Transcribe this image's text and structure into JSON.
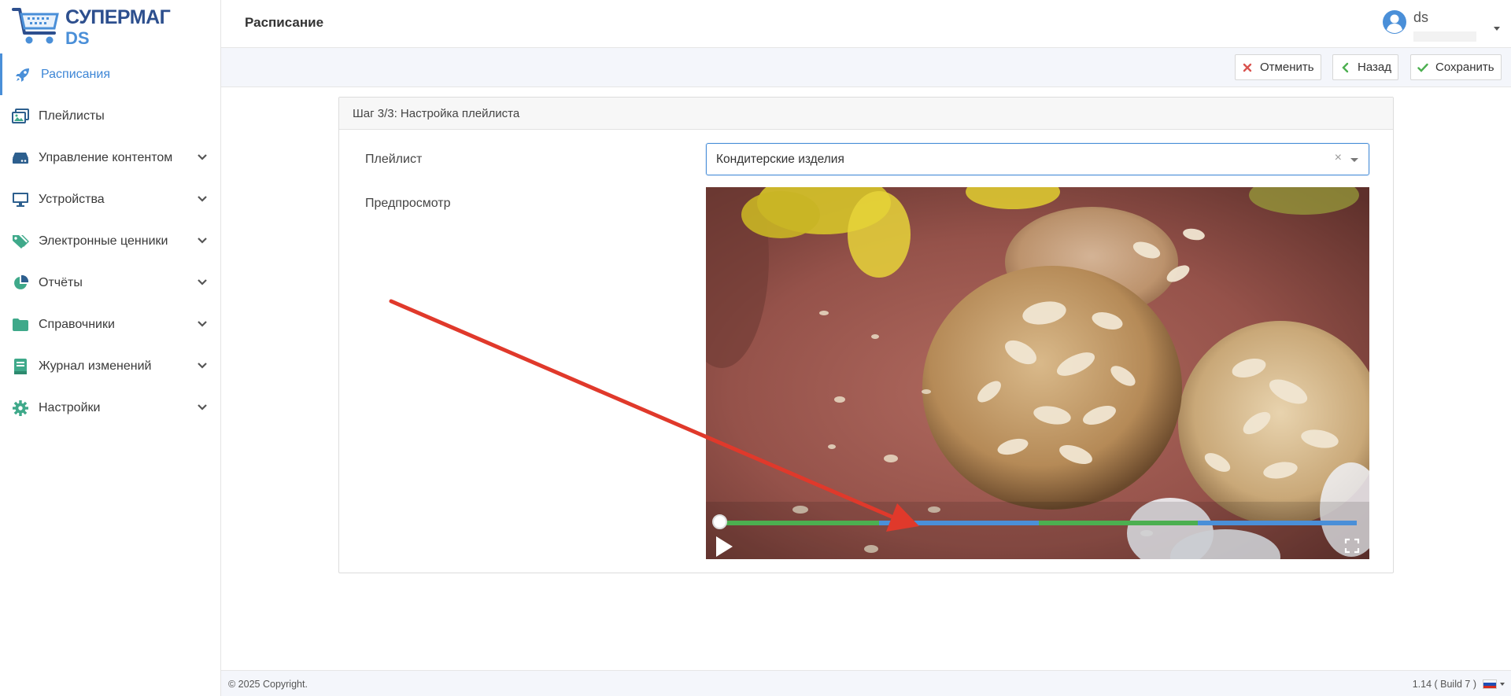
{
  "app": {
    "logo_line1": "СУПЕРМАГ",
    "logo_line2": "DS"
  },
  "sidebar": {
    "items": [
      {
        "label": "Расписания",
        "icon": "rocket-icon",
        "active": true,
        "expandable": false
      },
      {
        "label": "Плейлисты",
        "icon": "images-icon",
        "active": false,
        "expandable": false
      },
      {
        "label": "Управление контентом",
        "icon": "server-icon",
        "active": false,
        "expandable": true
      },
      {
        "label": "Устройства",
        "icon": "desktop-icon",
        "active": false,
        "expandable": true
      },
      {
        "label": "Электронные ценники",
        "icon": "tags-icon",
        "active": false,
        "expandable": true
      },
      {
        "label": "Отчёты",
        "icon": "pie-chart-icon",
        "active": false,
        "expandable": true
      },
      {
        "label": "Справочники",
        "icon": "folder-icon",
        "active": false,
        "expandable": true
      },
      {
        "label": "Журнал изменений",
        "icon": "book-icon",
        "active": false,
        "expandable": true
      },
      {
        "label": "Настройки",
        "icon": "gear-icon",
        "active": false,
        "expandable": true
      }
    ]
  },
  "header": {
    "title": "Расписание",
    "user_name": "ds"
  },
  "toolbar": {
    "cancel_label": "Отменить",
    "back_label": "Назад",
    "save_label": "Сохранить"
  },
  "wizard": {
    "step_title": "Шаг 3/3: Настройка плейлиста",
    "playlist_label": "Плейлист",
    "playlist_value": "Кондитерские изделия",
    "clear_symbol": "×",
    "preview_label": "Предпросмотр"
  },
  "player": {
    "progress": 0.0,
    "segments": [
      "#4caf50",
      "#4a8fd8",
      "#4caf50",
      "#4a8fd8"
    ]
  },
  "footer": {
    "copyright": "© 2025 Copyright.",
    "version": "1.14 ( Build 7 )"
  },
  "colors": {
    "accent": "#4a8fd8",
    "icon_green": "#3fa98a",
    "annotation_arrow": "#e0392b"
  }
}
